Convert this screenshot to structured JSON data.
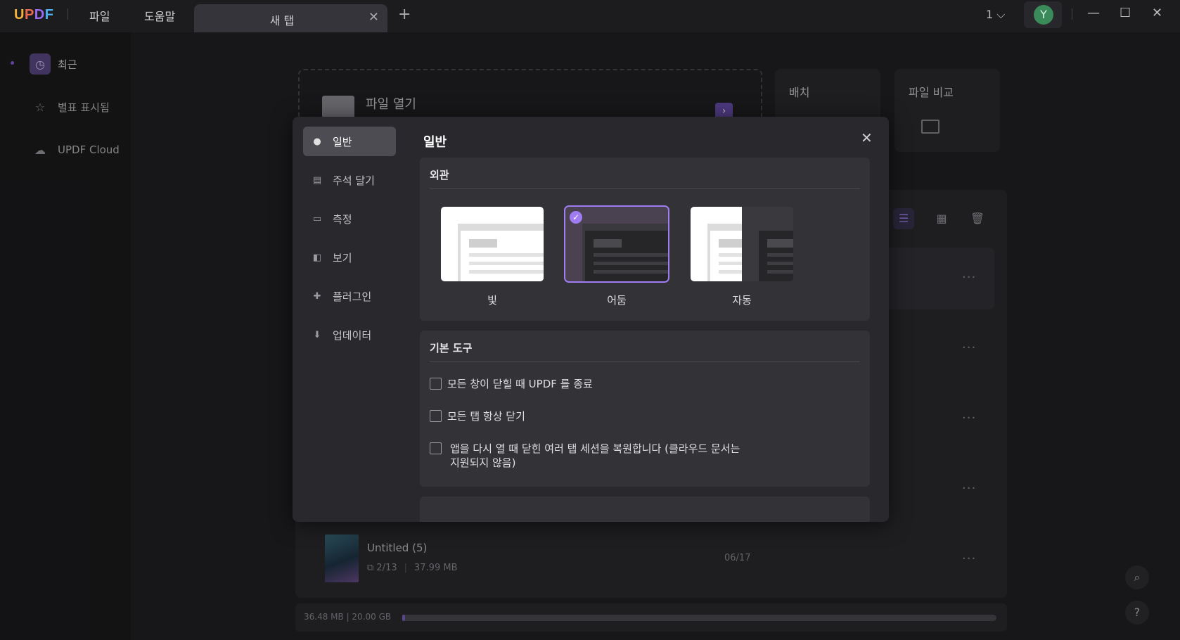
{
  "titlebar": {
    "logo": {
      "u": "U",
      "p": "P",
      "d": "D",
      "f": "F"
    },
    "menu_file": "파일",
    "menu_help": "도움말",
    "tab_label": "새 탭",
    "tab_close": "✕",
    "new_tab": "+",
    "window_count": "1 ⌵",
    "avatar_letter": "Y",
    "minimize": "—",
    "maximize": "☐",
    "close": "✕"
  },
  "sidebar": {
    "items": [
      {
        "label": "최근",
        "icon": "clock-icon",
        "glyph": "◷"
      },
      {
        "label": "별표 표시됨",
        "icon": "star-icon",
        "glyph": "☆"
      },
      {
        "label": "UPDF Cloud",
        "icon": "cloud-icon",
        "glyph": "☁"
      }
    ]
  },
  "home": {
    "open_file_label": "파일 열기",
    "batch_label": "배치",
    "compare_label": "파일 비교",
    "file": {
      "name": "Untitled (5)",
      "pages": "⧉ 2/13",
      "size": "37.99 MB",
      "date": "06/17"
    },
    "more": "···",
    "storage_text": "36.48 MB | 20.00 GB",
    "storage_used_fraction": 0.0018
  },
  "modal": {
    "title": "일반",
    "close": "✕",
    "nav": [
      {
        "label": "일반",
        "icon": "general-icon",
        "glyph": "●"
      },
      {
        "label": "주석 달기",
        "icon": "annotate-icon",
        "glyph": "▤"
      },
      {
        "label": "측정",
        "icon": "measure-icon",
        "glyph": "▭"
      },
      {
        "label": "보기",
        "icon": "view-icon",
        "glyph": "◧"
      },
      {
        "label": "플러그인",
        "icon": "plugin-icon",
        "glyph": "✚"
      },
      {
        "label": "업데이터",
        "icon": "update-icon",
        "glyph": "⬇"
      }
    ],
    "appearance": {
      "heading": "외관",
      "options": [
        "빛",
        "어둠",
        "자동"
      ],
      "selected": "어둠"
    },
    "basic_tools": {
      "heading": "기본 도구",
      "options": [
        {
          "label": "모든 창이 닫힐 때 UPDF 를 종료",
          "checked": false
        },
        {
          "label": "모든 탭 항상 닫기",
          "checked": false
        },
        {
          "label": "앱을 다시 열 때 닫힌 여러 탭 세션을 복원합니다 (클라우드 문서는",
          "label2": "지원되지 않음)",
          "checked": false
        }
      ]
    }
  },
  "colors": {
    "accent": "#9b7ee6",
    "background": "#202023",
    "modal": "#29292d"
  }
}
